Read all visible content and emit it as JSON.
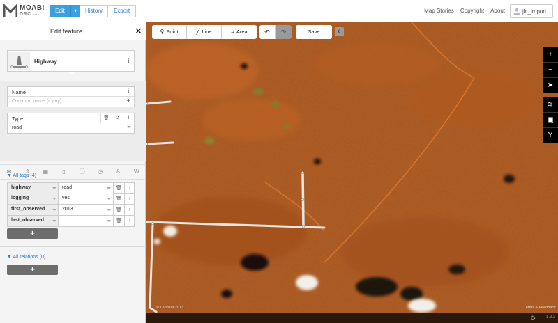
{
  "app": {
    "brand_main": "MOABI",
    "brand_sub": "DRC",
    "brand_beta": "beta"
  },
  "topbar": {
    "modes": {
      "edit": "Edit",
      "history": "History",
      "export": "Export"
    },
    "links": [
      "Map Stories",
      "Copyright",
      "About"
    ],
    "user": "jlc_import"
  },
  "sidebar": {
    "title": "Edit feature",
    "preset": {
      "name": "Highway"
    },
    "fields": {
      "name_label": "Name",
      "name_placeholder": "Common name (if any)",
      "type_label": "Type",
      "type_value": "road"
    },
    "all_tags_label": "All tags (4)",
    "tags": [
      {
        "key": "highway",
        "value": "road"
      },
      {
        "key": "logging",
        "value": "yes"
      },
      {
        "key": "first_observed",
        "value": "2013"
      },
      {
        "key": "last_observed",
        "value": ""
      }
    ],
    "all_relations_label": "All relations (0)"
  },
  "map": {
    "toolbar": {
      "point": "Point",
      "line": "Line",
      "area": "Area",
      "save": "Save",
      "change_count": "6"
    },
    "attribution_left": "© Landsat 2013",
    "attribution_right": "Terms & Feedback",
    "version": "1.3.3",
    "colors": {
      "background": "#a8511c",
      "road_stroke": "#e6e6e6"
    }
  }
}
